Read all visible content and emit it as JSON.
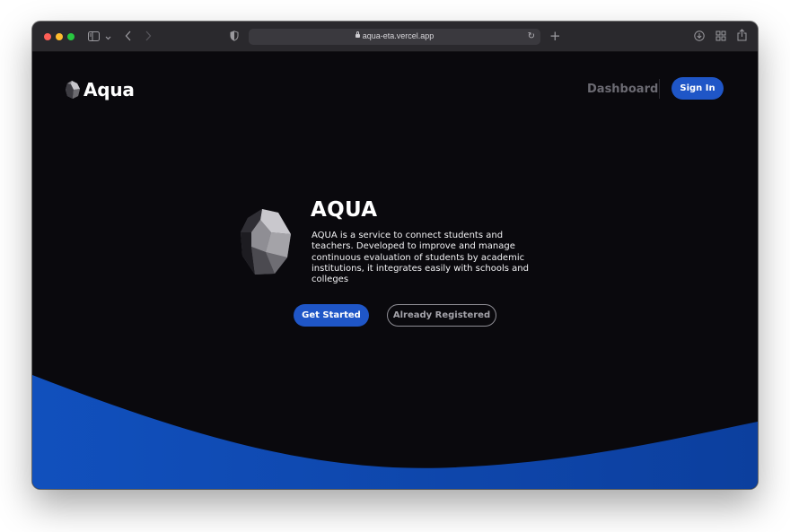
{
  "browser": {
    "url": "aqua-eta.vercel.app",
    "icons": {
      "sidebar": "sidebar-icon",
      "back": "chevron-left-icon",
      "forward": "chevron-right-icon",
      "shield": "shield-icon",
      "lock": "lock-icon",
      "reload": "reload-icon",
      "new_tab": "plus-icon",
      "downloads": "download-icon",
      "tabs_overview": "grid-icon",
      "share": "share-icon"
    }
  },
  "header": {
    "brand": "Aqua",
    "dashboard_link": "Dashboard",
    "sign_in_label": "Sign In"
  },
  "hero": {
    "title": "AQUA",
    "description": "AQUA is a service to connect students and teachers. Developed to improve and manage continuous evaluation of students by academic institutions, it integrates easily with schools and colleges",
    "get_started_label": "Get Started",
    "already_registered_label": "Already Registered"
  },
  "colors": {
    "background": "#0a090d",
    "accent": "#1f56c7",
    "wave": "#0e45a8",
    "titlebar": "#2a292d"
  }
}
